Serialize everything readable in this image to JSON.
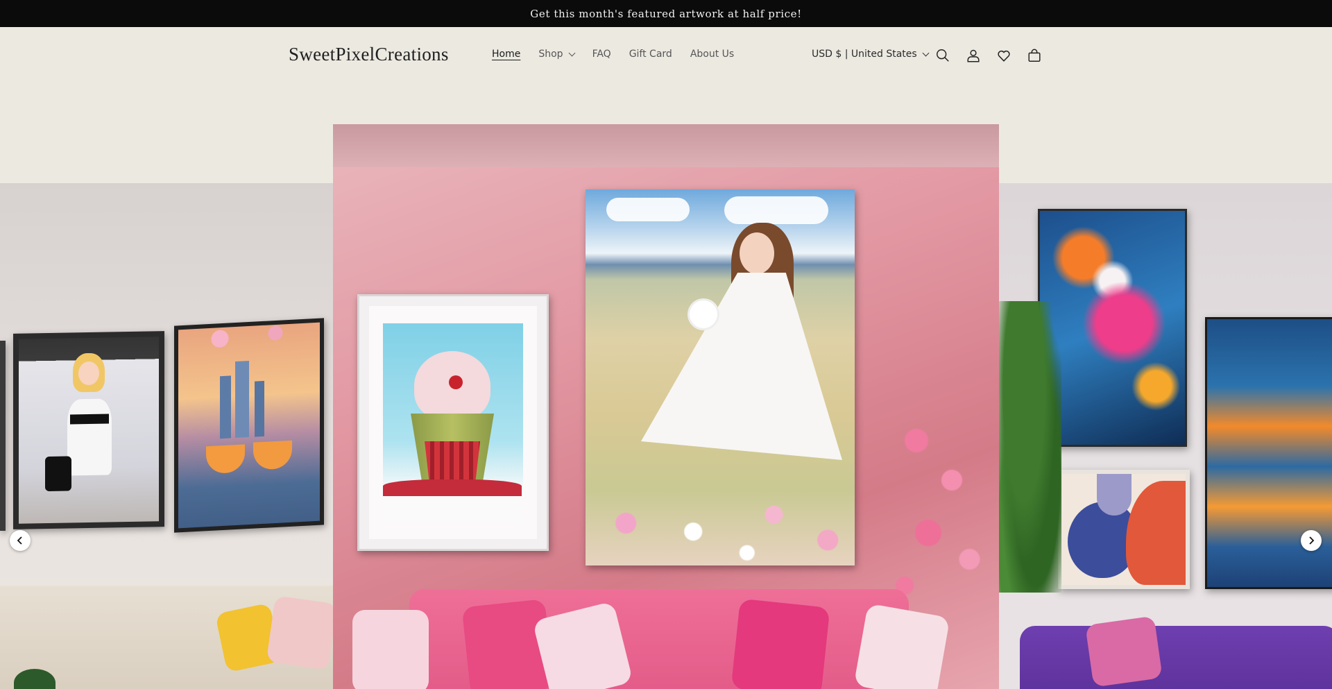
{
  "announcement": {
    "text": "Get this month's featured artwork at half price!"
  },
  "header": {
    "logo": "SweetPixelCreations",
    "nav": [
      {
        "label": "Home",
        "active": true
      },
      {
        "label": "Shop",
        "has_dropdown": true
      },
      {
        "label": "FAQ"
      },
      {
        "label": "Gift Card"
      },
      {
        "label": "About Us"
      }
    ],
    "currency": "USD $ | United States",
    "icons": [
      "search-icon",
      "account-icon",
      "wishlist-heart-icon",
      "cart-bag-icon"
    ]
  },
  "slideshow": {
    "prev_icon": "chevron-left-icon",
    "next_icon": "chevron-right-icon"
  },
  "colors": {
    "announcement_bg": "#0b0b0b",
    "page_bg": "#ece9e1",
    "center_wall": "#e39aa4"
  }
}
